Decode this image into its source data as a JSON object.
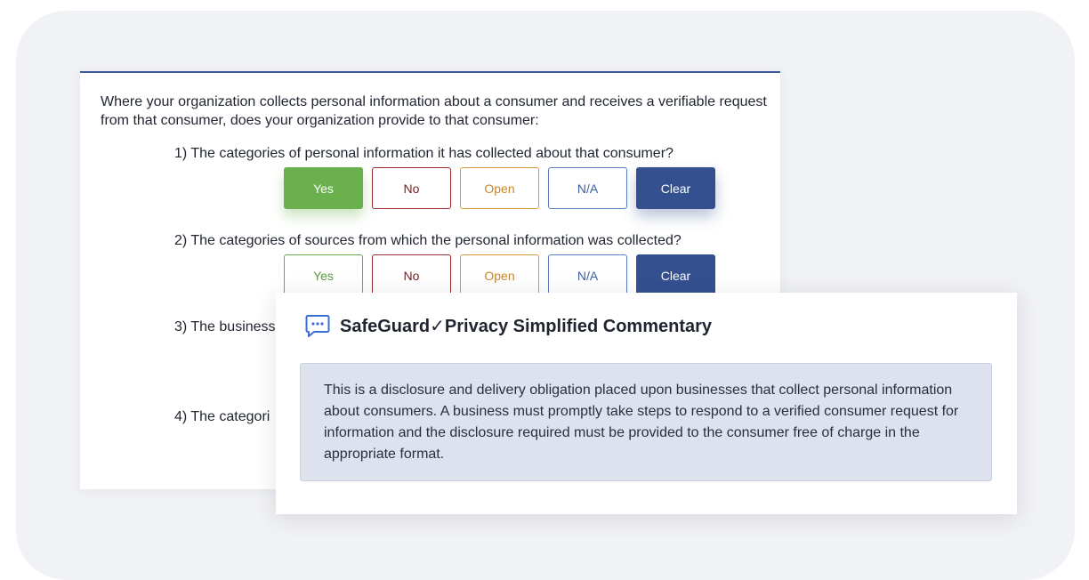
{
  "question": {
    "intro": "Where your organization collects personal information about a consumer and receives a verifiable request from that consumer, does your organization provide to that consumer:",
    "items": [
      {
        "text": "1) The categories of personal information it has collected about that consumer?",
        "selected": "Yes"
      },
      {
        "text": "2) The categories of sources from which the personal information was collected?",
        "selected": null
      },
      {
        "text": "3) The business"
      },
      {
        "text": "4) The categori"
      }
    ],
    "options": {
      "yes": "Yes",
      "no": "No",
      "open": "Open",
      "na": "N/A",
      "clear": "Clear"
    }
  },
  "commentary": {
    "icon": "chat-bubble-icon",
    "title": "SafeGuard✓Privacy Simplified Commentary",
    "body": "This is a disclosure and delivery obligation placed upon businesses that collect personal information about consumers. A business must promptly take steps to respond to a verified consumer request for information and the disclosure required must be provided to the consumer free of charge in the appropriate format."
  },
  "colors": {
    "accent": "#34508f",
    "yes": "#6ab04c",
    "no": "#9b2b2b",
    "open": "#d99b3c",
    "na": "#5b7dc6",
    "commentary_bg": "#dde2ee"
  }
}
